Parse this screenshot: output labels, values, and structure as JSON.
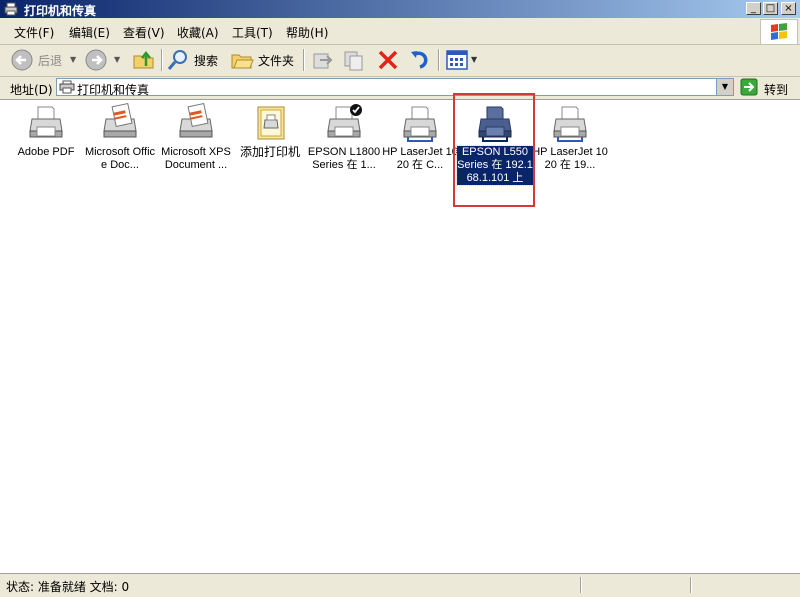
{
  "window": {
    "title": "打印机和传真"
  },
  "menu": [
    "文件(F)",
    "编辑(E)",
    "查看(V)",
    "收藏(A)",
    "工具(T)",
    "帮助(H)"
  ],
  "toolbar": {
    "back": "后退",
    "search": "搜索",
    "folders": "文件夹"
  },
  "address": {
    "label": "地址(D)",
    "value": "打印机和传真",
    "go": "转到"
  },
  "printers": [
    {
      "label": "Adobe PDF",
      "icon": "printer-icon"
    },
    {
      "label": "Microsoft Office Doc...",
      "icon": "printer-document-icon"
    },
    {
      "label": "Microsoft XPS Document ...",
      "icon": "printer-document-icon"
    },
    {
      "label": "添加打印机",
      "icon": "add-printer-icon"
    },
    {
      "label": "EPSON L1800 Series 在 1...",
      "icon": "default-printer-icon",
      "default": true
    },
    {
      "label": "HP LaserJet 1020 在 C...",
      "icon": "network-printer-icon"
    },
    {
      "label": "EPSON L550 Series 在 192.168.1.101 上",
      "icon": "network-printer-icon",
      "selected": true
    },
    {
      "label": "HP LaserJet 1020 在 19...",
      "icon": "network-printer-icon"
    }
  ],
  "status": {
    "text": "状态: 准备就绪 文档: 0"
  },
  "colors": {
    "title_start": "#0a246a",
    "title_end": "#a6caf0",
    "chrome": "#ece9d8",
    "selection": "#0a246a",
    "highlight_box": "#d9383a"
  }
}
